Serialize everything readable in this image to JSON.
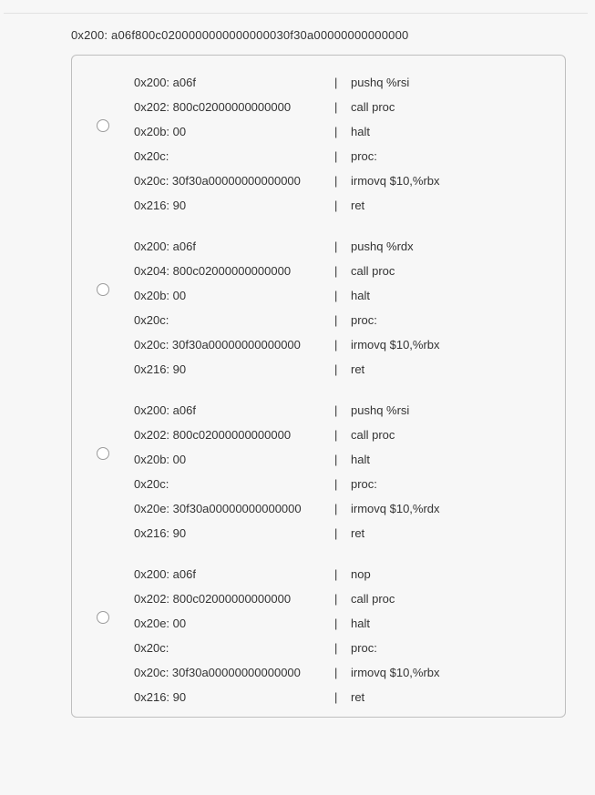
{
  "header": "0x200: a06f800c0200000000000000030f30a00000000000000",
  "options": [
    {
      "rows": [
        {
          "hex": "0x200: a06f",
          "instr": "pushq %rsi",
          "indent": true
        },
        {
          "hex": "0x202: 800c02000000000000",
          "instr": "call proc",
          "indent": true
        },
        {
          "hex": "0x20b: 00",
          "instr": "halt",
          "indent": true
        },
        {
          "hex": "0x20c:",
          "instr": "proc:",
          "indent": false
        },
        {
          "hex": "0x20c: 30f30a00000000000000",
          "instr": "irmovq $10,%rbx",
          "indent": true
        },
        {
          "hex": "0x216: 90",
          "instr": "ret",
          "indent": true
        }
      ]
    },
    {
      "rows": [
        {
          "hex": "0x200: a06f",
          "instr": "pushq %rdx",
          "indent": true
        },
        {
          "hex": "0x204: 800c02000000000000",
          "instr": "call proc",
          "indent": true
        },
        {
          "hex": "0x20b: 00",
          "instr": "halt",
          "indent": true
        },
        {
          "hex": "0x20c:",
          "instr": "proc:",
          "indent": false
        },
        {
          "hex": "0x20c: 30f30a00000000000000",
          "instr": "irmovq $10,%rbx",
          "indent": true
        },
        {
          "hex": "0x216: 90",
          "instr": "ret",
          "indent": true
        }
      ]
    },
    {
      "rows": [
        {
          "hex": "0x200: a06f",
          "instr": "pushq %rsi",
          "indent": true
        },
        {
          "hex": "0x202: 800c02000000000000",
          "instr": "call proc",
          "indent": true
        },
        {
          "hex": "0x20b: 00",
          "instr": "halt",
          "indent": true
        },
        {
          "hex": "0x20c:",
          "instr": "proc:",
          "indent": false
        },
        {
          "hex": "0x20e: 30f30a00000000000000",
          "instr": "irmovq $10,%rdx",
          "indent": true
        },
        {
          "hex": "0x216: 90",
          "instr": "ret",
          "indent": true
        }
      ]
    },
    {
      "rows": [
        {
          "hex": "0x200: a06f",
          "instr": "nop",
          "indent": true
        },
        {
          "hex": "0x202: 800c02000000000000",
          "instr": "call proc",
          "indent": true
        },
        {
          "hex": "0x20e: 00",
          "instr": "halt",
          "indent": true
        },
        {
          "hex": "0x20c:",
          "instr": "proc:",
          "indent": false
        },
        {
          "hex": "0x20c: 30f30a00000000000000",
          "instr": "irmovq $10,%rbx",
          "indent": true
        },
        {
          "hex": "0x216: 90",
          "instr": "ret",
          "indent": true
        }
      ]
    }
  ]
}
